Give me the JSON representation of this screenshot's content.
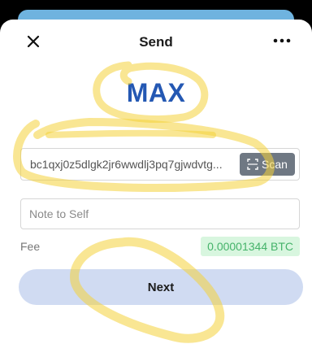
{
  "header": {
    "title": "Send",
    "close_icon": "close-icon",
    "more_icon": "more-horizontal-icon"
  },
  "amount": {
    "value": "MAX"
  },
  "address_field": {
    "value": "bc1qxj0z5dlgk2jr6wwdlj3pq7gjwdvtg..."
  },
  "scan_button": {
    "label": "Scan",
    "icon": "scan-icon"
  },
  "note_field": {
    "placeholder": "Note to Self",
    "value": ""
  },
  "fee": {
    "label": "Fee",
    "value": "0.00001344 BTC"
  },
  "next_button": {
    "label": "Next"
  },
  "colors": {
    "accent": "#2458b3",
    "top_strip": "#6fb3df",
    "scan_button": "#6f7883",
    "fee_badge_bg": "#d8f6df",
    "fee_badge_text": "#45b36a",
    "next_button_bg": "#d0dbf2",
    "highlight_marker": "#f4d13a"
  }
}
